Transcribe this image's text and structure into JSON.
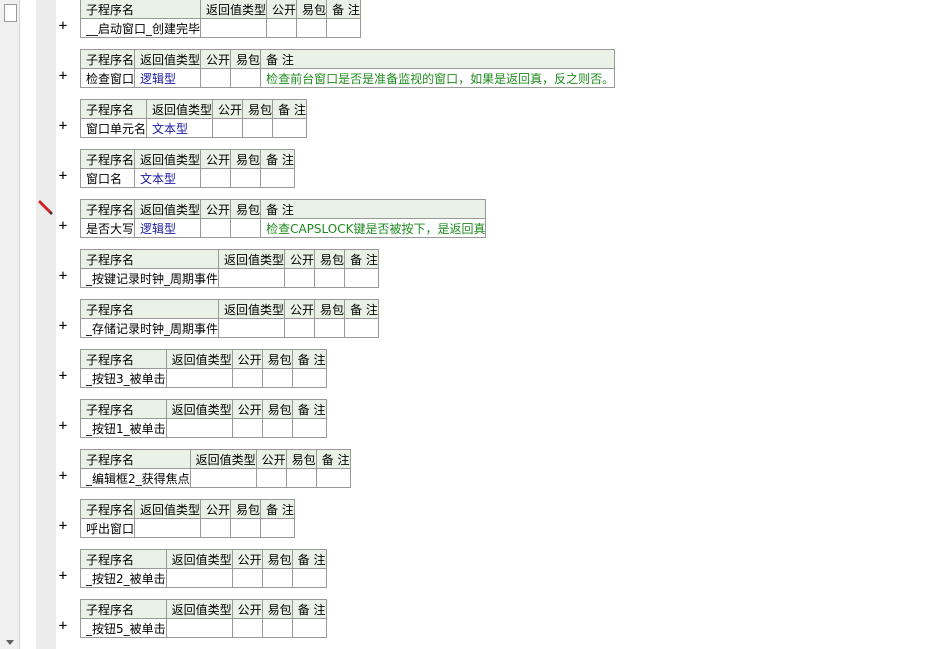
{
  "header": {
    "name": "子程序名",
    "ret": "返回值类型",
    "pub": "公开",
    "easy": "易包",
    "note": "备 注"
  },
  "subs": [
    {
      "name": "__启动窗口_创建完毕",
      "ret": "",
      "note": ""
    },
    {
      "name": "检查窗口",
      "ret": "逻辑型",
      "note": "检查前台窗口是否是准备监视的窗口，如果是返回真，反之则否。"
    },
    {
      "name": "窗口单元名",
      "ret": "文本型",
      "note": ""
    },
    {
      "name": "窗口名",
      "ret": "文本型",
      "note": ""
    },
    {
      "name": "是否大写",
      "ret": "逻辑型",
      "note": "检查CAPSLOCK键是否被按下，是返回真"
    },
    {
      "name": "_按键记录时钟_周期事件",
      "ret": "",
      "note": ""
    },
    {
      "name": "_存储记录时钟_周期事件",
      "ret": "",
      "note": ""
    },
    {
      "name": "_按钮3_被单击",
      "ret": "",
      "note": ""
    },
    {
      "name": "_按钮1_被单击",
      "ret": "",
      "note": ""
    },
    {
      "name": "_编辑框2_获得焦点",
      "ret": "",
      "note": ""
    },
    {
      "name": "呼出窗口",
      "ret": "",
      "note": ""
    },
    {
      "name": "_按钮2_被单击",
      "ret": "",
      "note": ""
    },
    {
      "name": "_按钮5_被单击",
      "ret": "",
      "note": ""
    }
  ],
  "expand_symbol": "+",
  "icons": {
    "marker": "pencil-icon"
  },
  "colors": {
    "header_bg": "#eaf1e6",
    "grid": "#999999",
    "type_text": "#1a1aa0",
    "note_text": "#1f8b1f",
    "marker": "#cc2222"
  }
}
